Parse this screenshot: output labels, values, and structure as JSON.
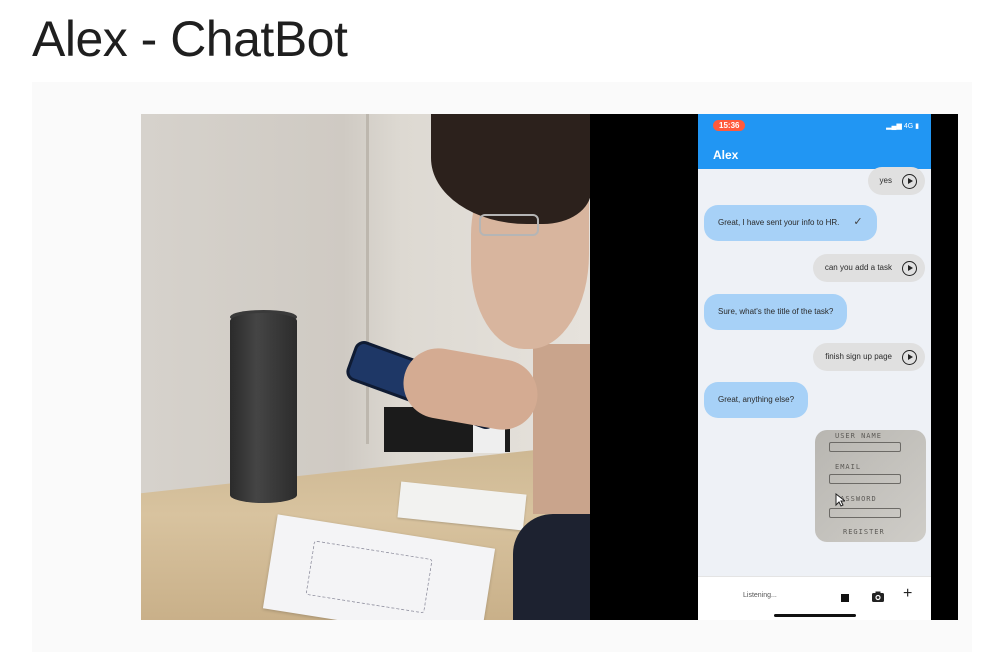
{
  "slide": {
    "title": "Alex - ChatBot"
  },
  "phone": {
    "status_time": "15:36",
    "status_right": "4G",
    "app_title": "Alex",
    "messages": [
      {
        "from": "user",
        "text": "yes"
      },
      {
        "from": "bot",
        "text": "Great, I have sent your info to HR."
      },
      {
        "from": "user",
        "text": "can you add a task"
      },
      {
        "from": "bot",
        "text": "Sure, what's the title of the task?"
      },
      {
        "from": "user",
        "text": "finish sign up page"
      },
      {
        "from": "bot",
        "text": "Great, anything else?"
      }
    ],
    "image_message": {
      "sketch_labels": [
        "USER NAME",
        "EMAIL",
        "PASSWORD",
        "REGISTER"
      ]
    },
    "input_status": "Listening..."
  },
  "colors": {
    "appbar": "#2196f3",
    "bot_bubble": "#a7d1f7",
    "user_bubble": "#e0e0e0",
    "status_time_badge": "#ff5a3c"
  },
  "icons": [
    "play-icon",
    "check-icon",
    "stop-icon",
    "camera-icon",
    "plus-icon",
    "cursor-icon"
  ]
}
